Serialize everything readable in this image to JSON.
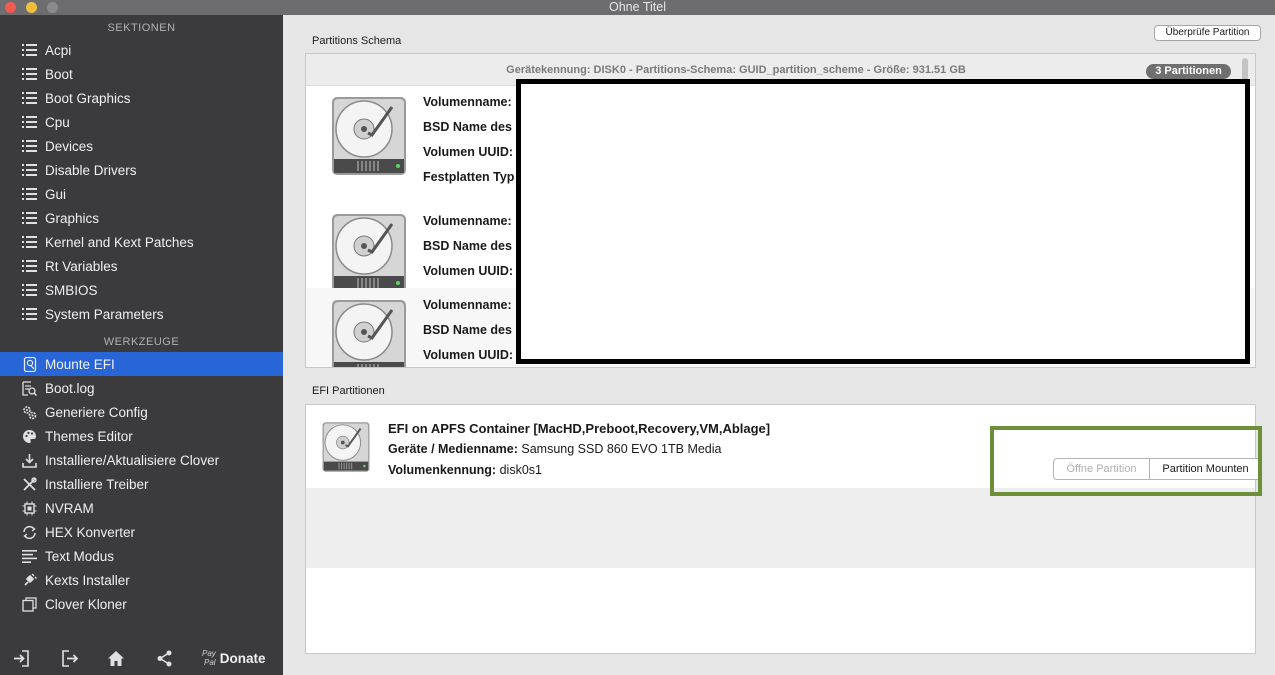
{
  "window": {
    "title": "Ohne Titel"
  },
  "sidebar": {
    "sections_heading": "SEKTIONEN",
    "sections": [
      {
        "label": "Acpi"
      },
      {
        "label": "Boot"
      },
      {
        "label": "Boot Graphics"
      },
      {
        "label": "Cpu"
      },
      {
        "label": "Devices"
      },
      {
        "label": "Disable Drivers"
      },
      {
        "label": "Gui"
      },
      {
        "label": "Graphics"
      },
      {
        "label": "Kernel and Kext Patches"
      },
      {
        "label": "Rt Variables"
      },
      {
        "label": "SMBIOS"
      },
      {
        "label": "System Parameters"
      }
    ],
    "tools_heading": "WERKZEUGE",
    "tools": [
      {
        "label": "Mounte EFI",
        "icon": "drive-icon",
        "selected": true
      },
      {
        "label": "Boot.log",
        "icon": "log-icon"
      },
      {
        "label": "Generiere Config",
        "icon": "gears-icon"
      },
      {
        "label": "Themes Editor",
        "icon": "palette-icon"
      },
      {
        "label": "Installiere/Aktualisiere Clover",
        "icon": "download-icon"
      },
      {
        "label": "Installiere Treiber",
        "icon": "wrench-icon"
      },
      {
        "label": "NVRAM",
        "icon": "chip-icon"
      },
      {
        "label": "HEX Konverter",
        "icon": "convert-icon"
      },
      {
        "label": "Text Modus",
        "icon": "text-icon"
      },
      {
        "label": "Kexts Installer",
        "icon": "plug-icon"
      },
      {
        "label": "Clover Kloner",
        "icon": "clone-icon"
      }
    ],
    "footer": {
      "paypal_line1": "Pay",
      "paypal_line2": "Pal",
      "donate": "Donate"
    }
  },
  "main": {
    "check_button": "Überprüfe Partition",
    "schema_label": "Partitions Schema",
    "schema_info": "Gerätekennung: DISK0 - Partitions-Schema: GUID_partition_scheme - Größe: 931.51 GB",
    "partition_count": "3 Partitionen",
    "partitions": [
      {
        "fields": [
          "Volumenname:",
          "BSD Name des",
          "Volumen UUID:",
          "Festplatten Typ"
        ]
      },
      {
        "fields": [
          "Volumenname:",
          "BSD Name des",
          "Volumen UUID:"
        ]
      },
      {
        "fields": [
          "Volumenname:",
          "BSD Name des",
          "Volumen UUID:"
        ]
      }
    ],
    "efi_label": "EFI Partitionen",
    "efi": {
      "title": "EFI on APFS Container [MacHD,Preboot,Recovery,VM,Ablage]",
      "media_label": "Geräte / Medienname:",
      "media_value": "Samsung SSD 860 EVO 1TB Media",
      "volume_label": "Volumenkennung:",
      "volume_value": "disk0s1",
      "open_button": "Öffne Partition",
      "mount_button": "Partition Mounten"
    }
  }
}
